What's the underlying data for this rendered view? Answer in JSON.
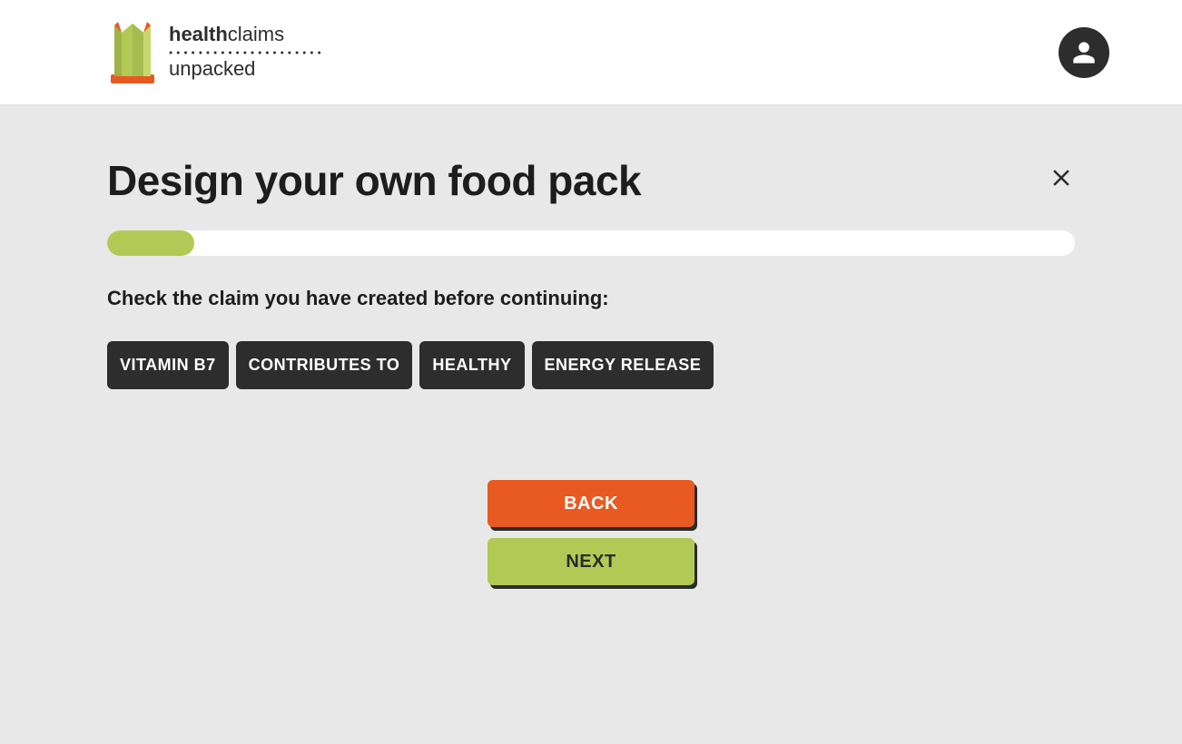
{
  "header": {
    "logo_top_bold": "health",
    "logo_top_light": "claims",
    "logo_bottom": "unpacked"
  },
  "page": {
    "title": "Design your own food pack",
    "instruction": "Check the claim you have created before continuing:",
    "progress_percent": 9
  },
  "chips": [
    "VITAMIN B7",
    "CONTRIBUTES TO",
    "HEALTHY",
    "ENERGY RELEASE"
  ],
  "buttons": {
    "back": "BACK",
    "next": "NEXT"
  },
  "colors": {
    "accent_green": "#b3c956",
    "accent_orange": "#e85a22",
    "dark": "#2d2d2d"
  }
}
